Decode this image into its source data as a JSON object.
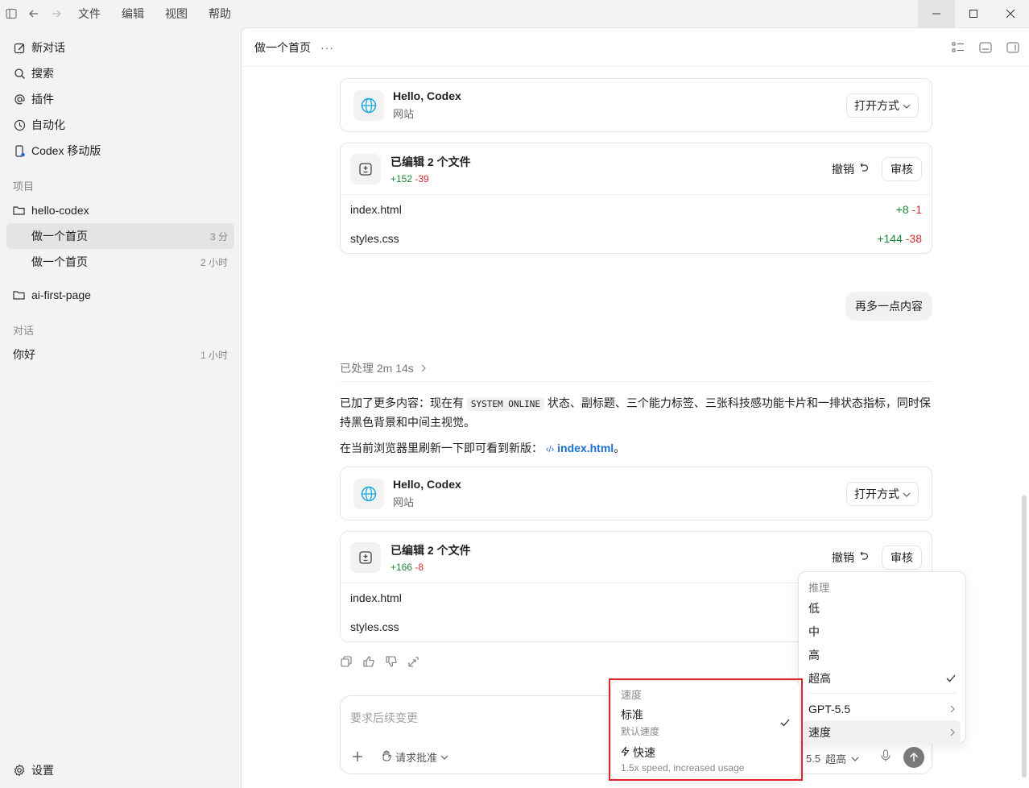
{
  "menubar": {
    "items": [
      "文件",
      "编辑",
      "视图",
      "帮助"
    ]
  },
  "sidebar": {
    "nav": [
      "新对话",
      "搜索",
      "插件",
      "自动化",
      "Codex 移动版"
    ],
    "projects_label": "项目",
    "projects": [
      {
        "name": "hello-codex",
        "threads": [
          {
            "title": "做一个首页",
            "time": "3 分"
          },
          {
            "title": "做一个首页",
            "time": "2 小时"
          }
        ]
      },
      {
        "name": "ai-first-page"
      }
    ],
    "chats_label": "对话",
    "chats": [
      {
        "title": "你好",
        "time": "1 小时"
      }
    ],
    "settings": "设置"
  },
  "header": {
    "title": "做一个首页",
    "more": "···"
  },
  "site_card": {
    "title": "Hello, Codex",
    "sub": "网站",
    "open": "打开方式"
  },
  "edit_card_1": {
    "title": "已编辑 2 个文件",
    "plus": "+152",
    "minus": "-39",
    "undo": "撤销",
    "review": "审核",
    "files": [
      {
        "name": "index.html",
        "plus": "+8",
        "minus": "-1"
      },
      {
        "name": "styles.css",
        "plus": "+144",
        "minus": "-38"
      }
    ]
  },
  "user_message": "再多一点内容",
  "processed": "已处理 2m 14s",
  "reply": {
    "p1_a": "已加了更多内容：现在有",
    "p1_code": "SYSTEM ONLINE",
    "p1_b": "状态、副标题、三个能力标签、三张科技感功能卡片和一排状态指标，同时保持黑色背景和中间主视觉。",
    "p2_a": "在当前浏览器里刷新一下即可看到新版：",
    "p2_link": "index.html",
    "p2_b": "。"
  },
  "edit_card_2": {
    "title": "已编辑 2 个文件",
    "plus": "+166",
    "minus": "-8",
    "undo": "撤销",
    "review": "审核",
    "files": [
      {
        "name": "index.html"
      },
      {
        "name": "styles.css"
      }
    ]
  },
  "composer": {
    "placeholder": "要求后续变更",
    "approval": "请求批准",
    "model": "5.5",
    "effort": "超高"
  },
  "reasoning_menu": {
    "header": "推理",
    "options": [
      "低",
      "中",
      "高",
      "超高"
    ],
    "model": "GPT-5.5",
    "speed": "速度"
  },
  "speed_menu": {
    "header": "速度",
    "standard": {
      "name": "标准",
      "desc": "默认速度"
    },
    "fast": {
      "name": "快速",
      "desc": "1.5x speed, increased usage"
    }
  }
}
